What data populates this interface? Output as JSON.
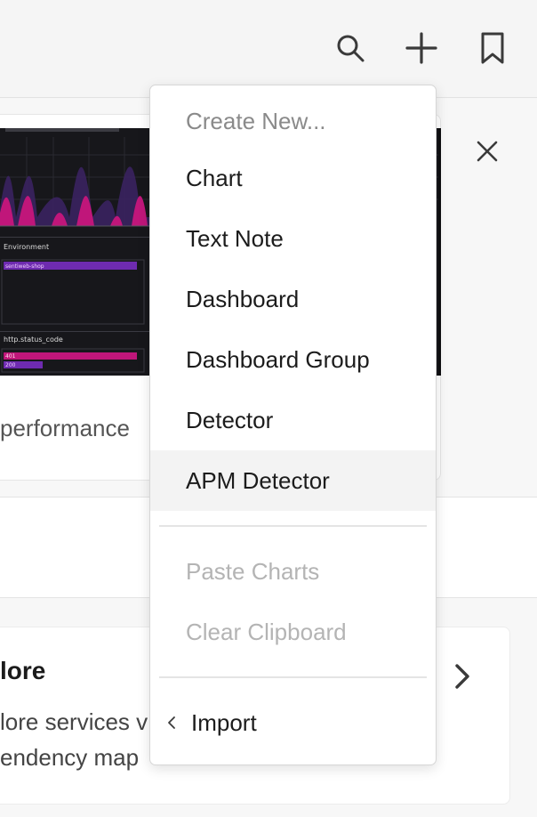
{
  "toolbar": {
    "search_icon": "search-icon",
    "add_icon": "plus-icon",
    "bookmark_icon": "bookmark-icon"
  },
  "preview_card": {
    "section_labels": [
      "Environment",
      "http.status_code"
    ],
    "bar_labels": [
      "sentiweb-shop",
      "401",
      "200"
    ],
    "text": "performance"
  },
  "explore_card": {
    "title": "lore",
    "line1": "lore services v",
    "line2": "endency map"
  },
  "menu": {
    "header": "Create New...",
    "items": [
      "Chart",
      "Text Note",
      "Dashboard",
      "Dashboard Group",
      "Detector",
      "APM Detector"
    ],
    "disabled_items": [
      "Paste Charts",
      "Clear Clipboard"
    ],
    "import_label": "Import"
  },
  "colors": {
    "accent_pink": "#d4147a",
    "accent_purple": "#6e2bb0",
    "preview_bg": "#17171b"
  }
}
